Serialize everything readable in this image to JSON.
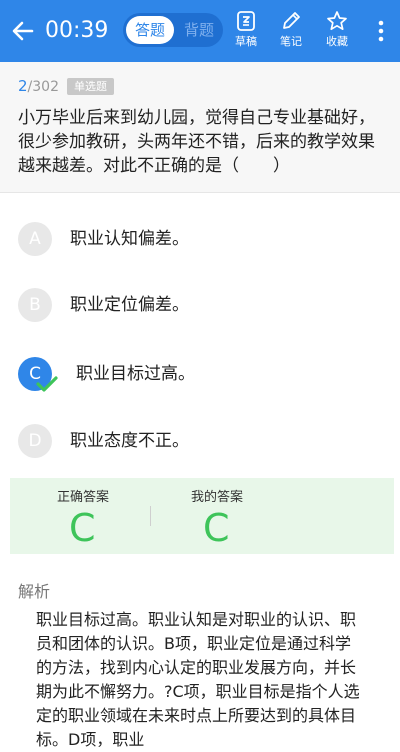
{
  "header": {
    "timer": "00:39",
    "tabs": [
      {
        "label": "答题",
        "active": true
      },
      {
        "label": "背题",
        "active": false
      }
    ],
    "tools": [
      {
        "label": "草稿",
        "icon": "draft-icon"
      },
      {
        "label": "笔记",
        "icon": "pencil-icon"
      },
      {
        "label": "收藏",
        "icon": "star-icon"
      }
    ]
  },
  "question": {
    "current": "2",
    "total": "/302",
    "type": "单选题",
    "text": "小万毕业后来到幼儿园，觉得自己专业基础好，很少参加教研，头两年还不错，后来的教学效果越来越差。对此不正确的是（　　）"
  },
  "options": [
    {
      "letter": "A",
      "text": "职业认知偏差。",
      "selected": false
    },
    {
      "letter": "B",
      "text": "职业定位偏差。",
      "selected": false
    },
    {
      "letter": "C",
      "text": "职业目标过高。",
      "selected": true
    },
    {
      "letter": "D",
      "text": "职业态度不正。",
      "selected": false
    }
  ],
  "answer": {
    "correct_label": "正确答案",
    "correct_value": "C",
    "mine_label": "我的答案",
    "mine_value": "C",
    "color": "#3ec45a"
  },
  "analysis": {
    "title": "解析",
    "text": "职业目标过高。职业认知是对职业的认识、职员和团体的认识。B项，职业定位是通过科学的方法，找到内心认定的职业发展方向，并长期为此不懈努力。?C项，职业目标是指个人选定的职业领域在未来时点上所要达到的具体目标。D项，职业"
  },
  "colors": {
    "accent": "#2f86e8",
    "correct": "#3ec45a"
  }
}
